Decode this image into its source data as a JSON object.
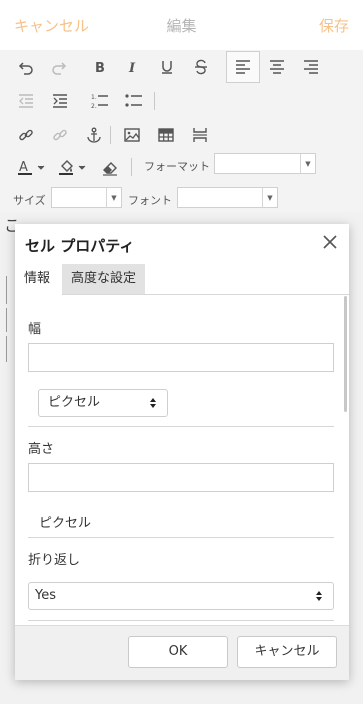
{
  "header": {
    "cancel_label": "キャンセル",
    "title": "編集",
    "save_label": "保存"
  },
  "toolbar": {
    "format_label": "フォーマット",
    "size_label": "サイズ",
    "font_label": "フォント",
    "format_value": "",
    "size_value": "",
    "font_value": ""
  },
  "document": {
    "visible_glyph": "こ"
  },
  "dialog": {
    "title": "セル プロパティ",
    "tabs": [
      {
        "label": "情報"
      },
      {
        "label": "高度な設定"
      }
    ],
    "width": {
      "label": "幅",
      "value": "",
      "unit": "ピクセル"
    },
    "height": {
      "label": "高さ",
      "value": "",
      "unit": "ピクセル"
    },
    "wrap": {
      "label": "折り返し",
      "value": "Yes"
    },
    "ok_label": "OK",
    "cancel_label": "キャンセル"
  },
  "colors": {
    "accent": "#f6c28a",
    "title_gray": "#b5b5b5"
  }
}
